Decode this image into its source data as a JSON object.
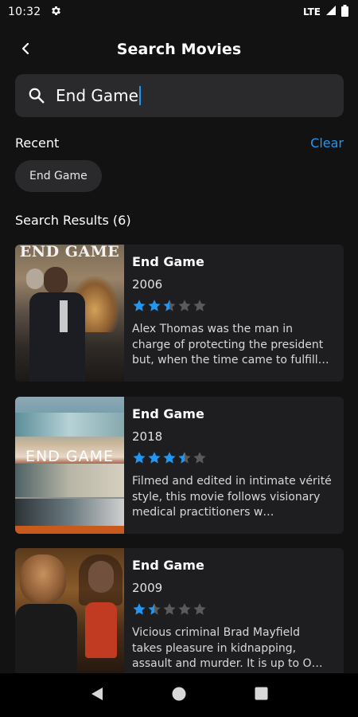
{
  "status_bar": {
    "time": "10:32",
    "network": "LTE"
  },
  "app_bar": {
    "title": "Search Movies"
  },
  "search": {
    "value": "End Game"
  },
  "recent": {
    "label": "Recent",
    "clear_label": "Clear",
    "chips": [
      "End Game"
    ]
  },
  "results": {
    "label": "Search Results (6)",
    "items": [
      {
        "title": "End Game",
        "year": "2006",
        "rating_stars": 2.5,
        "poster_text": "END GAME",
        "description": "Alex Thomas was the man in charge of protecting the president but, when the time came to fulfill…"
      },
      {
        "title": "End Game",
        "year": "2018",
        "rating_stars": 3.5,
        "poster_text": "END GAME",
        "description": "Filmed and edited in intimate vérité style, this movie follows visionary medical practitioners w…"
      },
      {
        "title": "End Game",
        "year": "2009",
        "rating_stars": 1.5,
        "poster_text": "",
        "description": "Vicious criminal Brad Mayfield takes pleasure in kidnapping, assault and murder. It is up to O…"
      }
    ]
  },
  "colors": {
    "accent": "#2196f3",
    "star_filled": "#2196f3",
    "star_empty": "#5a5a5a",
    "background": "#121212",
    "surface": "#2a2a2c"
  },
  "icons": {
    "back": "arrow-back-icon",
    "search": "search-icon",
    "settings": "gear-icon"
  }
}
